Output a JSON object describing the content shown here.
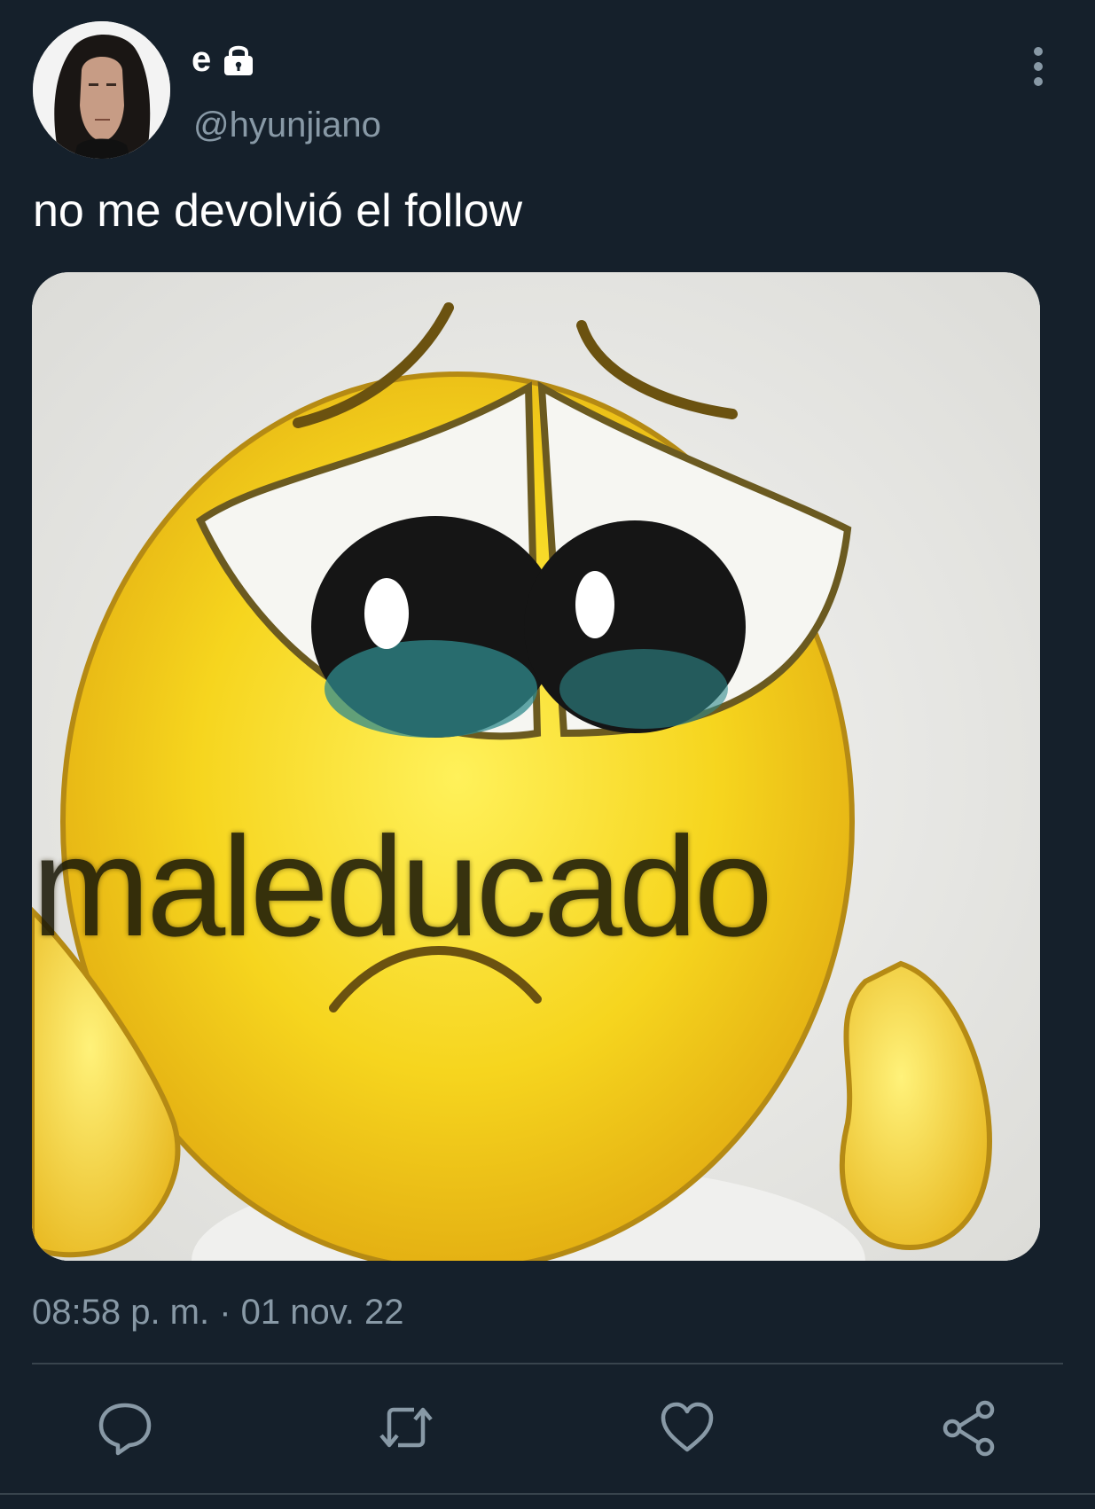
{
  "tweet": {
    "display_name": "e",
    "handle": "@hyunjiano",
    "text": "no me devolvió el follow",
    "timestamp": "08:58 p. m. · 01 nov. 22",
    "protected_icon": "lock-icon",
    "media": {
      "caption": "maleducado",
      "description_icon": "pleading-face-emoji"
    }
  },
  "actions": {
    "reply_icon": "reply-icon",
    "retweet_icon": "retweet-icon",
    "like_icon": "heart-icon",
    "share_icon": "share-icon",
    "more_icon": "more-vertical-icon"
  },
  "colors": {
    "background": "#15202b",
    "text_primary": "#ffffff",
    "text_secondary": "#8899a6",
    "divider": "#38444d"
  }
}
